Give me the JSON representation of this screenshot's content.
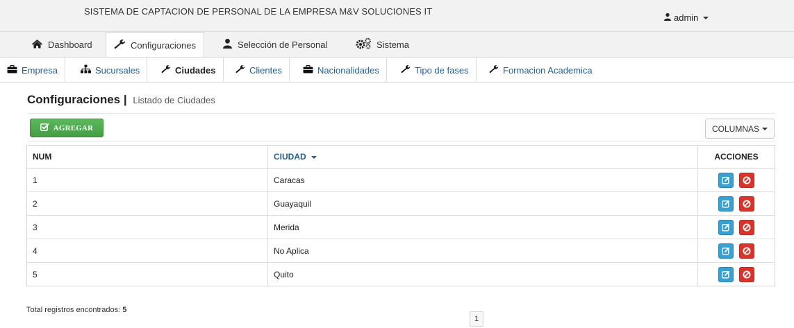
{
  "app": {
    "title": "SISTEMA DE CAPTACION DE PERSONAL DE LA EMPRESA M&V SOLUCIONES IT"
  },
  "user_menu": {
    "label": "admin",
    "icon": "user-icon"
  },
  "main_nav": [
    {
      "label": "Dashboard",
      "icon": "home-icon",
      "active": false
    },
    {
      "label": "Configuraciones",
      "icon": "wrench-icon",
      "active": true
    },
    {
      "label": "Selección de Personal",
      "icon": "user-icon",
      "active": false
    },
    {
      "label": "Sistema",
      "icon": "cogs-icon",
      "active": false
    }
  ],
  "sub_nav": [
    {
      "label": "Empresa",
      "icon": "briefcase-icon",
      "active": false
    },
    {
      "label": "Sucursales",
      "icon": "sitemap-icon",
      "active": false
    },
    {
      "label": "Ciudades",
      "icon": "wrench-icon",
      "active": true
    },
    {
      "label": "Clientes",
      "icon": "wrench-icon",
      "active": false
    },
    {
      "label": "Nacionalidades",
      "icon": "briefcase-icon",
      "active": false
    },
    {
      "label": "Tipo de fases",
      "icon": "wrench-icon",
      "active": false
    },
    {
      "label": "Formacion Academica",
      "icon": "wrench-icon",
      "active": false
    }
  ],
  "page": {
    "heading": "Configuraciones",
    "separator": "|",
    "subheading": "Listado de Ciudades"
  },
  "toolbar": {
    "add_label": "AGREGAR",
    "columns_label": "COLUMNAS"
  },
  "table": {
    "headers": {
      "num": "NUM",
      "ciudad": "CIUDAD",
      "acciones": "ACCIONES"
    },
    "rows": [
      {
        "num": "1",
        "ciudad": "Caracas"
      },
      {
        "num": "2",
        "ciudad": "Guayaquil"
      },
      {
        "num": "3",
        "ciudad": "Merida"
      },
      {
        "num": "4",
        "ciudad": "No Aplica"
      },
      {
        "num": "5",
        "ciudad": "Quito"
      }
    ]
  },
  "footer": {
    "total_label": "Total registros encontrados:",
    "total_value": "5",
    "page": "1"
  },
  "colors": {
    "add_button": "#5cb85c",
    "edit_button": "#3aa0cf",
    "delete_button": "#d9342b",
    "link": "#1f5f96"
  }
}
